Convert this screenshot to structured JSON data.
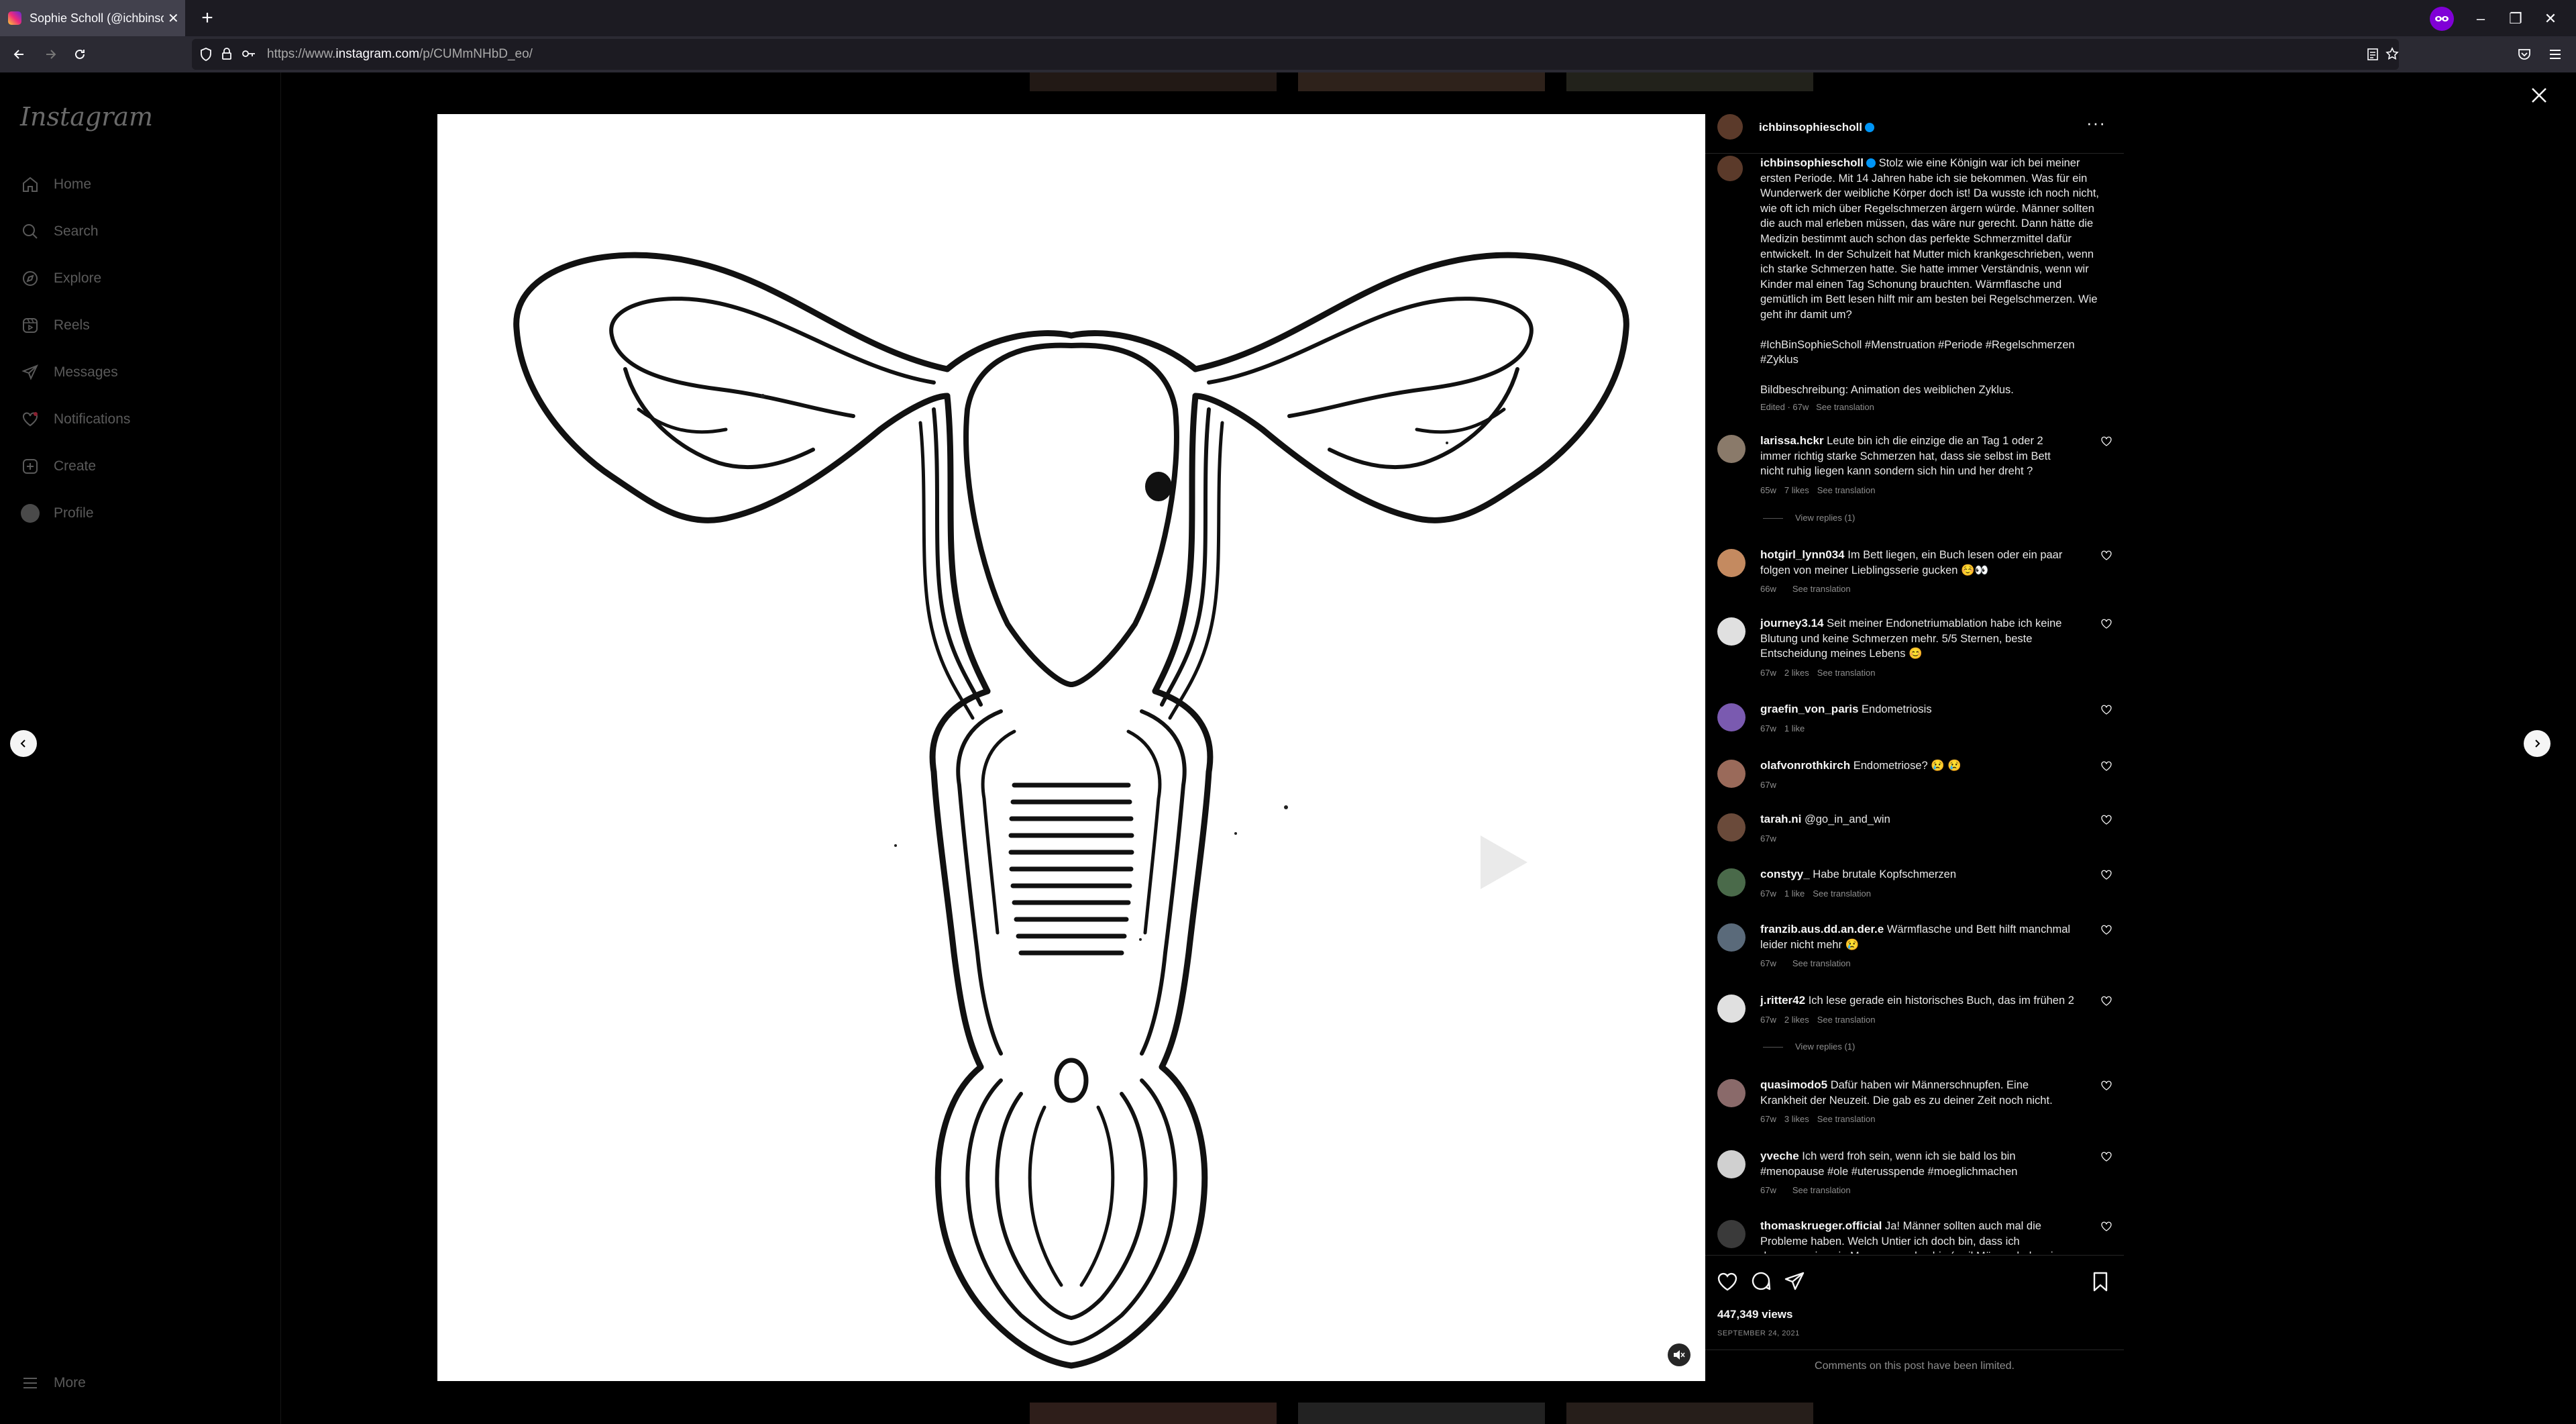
{
  "browser": {
    "tab_title": "Sophie Scholl (@ichbinsophiescholl)",
    "url_prefix": "https://www.",
    "url_domain": "instagram.com",
    "url_path": "/p/CUMmNHbD_eo/"
  },
  "sidenav": {
    "logo": "Instagram",
    "items": [
      {
        "label": "Home"
      },
      {
        "label": "Search"
      },
      {
        "label": "Explore"
      },
      {
        "label": "Reels"
      },
      {
        "label": "Messages"
      },
      {
        "label": "Notifications"
      },
      {
        "label": "Create"
      },
      {
        "label": "Profile"
      }
    ],
    "more": "More"
  },
  "post": {
    "author": "ichbinsophiescholl",
    "caption": "Stolz wie eine Königin war ich bei meiner ersten Periode. Mit 14 Jahren habe ich sie bekommen. Was für ein Wunderwerk der weibliche Körper doch ist! Da wusste ich noch nicht, wie oft ich mich über Regelschmerzen ärgern würde. Männer sollten die auch mal erleben müssen, das wäre nur gerecht. Dann hätte die Medizin bestimmt auch schon das perfekte Schmerzmittel dafür entwickelt. In der Schulzeit hat Mutter mich krankgeschrieben, wenn ich starke Schmerzen hatte. Sie hatte immer Verständnis, wenn wir Kinder mal einen Tag Schonung brauchten. Wärmflasche und gemütlich im Bett lesen hilft mir am besten bei Regelschmerzen. Wie geht ihr damit um?",
    "hashtags": "#IchBinSophieScholl #Menstruation #Periode #Regelschmerzen #Zyklus",
    "image_description": "Bildbeschreibung: Animation des weiblichen Zyklus.",
    "edited_meta": "Edited · 67w",
    "see_translation": "See translation",
    "views": "447,349 views",
    "date": "SEPTEMBER 24, 2021",
    "limited": "Comments on this post have been limited."
  },
  "comments": [
    {
      "user": "larissa.hckr",
      "text": "Leute bin ich die einzige die an Tag 1 oder 2 immer richtig starke Schmerzen hat, dass sie selbst im Bett nicht ruhig liegen kann sondern sich hin und her dreht ?",
      "age": "65w",
      "likes": "7 likes",
      "translation": "See translation",
      "replies": "View replies (1)",
      "avatar": "#8a7a6a"
    },
    {
      "user": "hotgirl_lynn034",
      "text": "Im Bett liegen, ein Buch lesen oder ein paar folgen von meiner Lieblingsserie gucken ☺️👀",
      "age": "66w",
      "likes": "",
      "translation": "See translation",
      "avatar": "#c48a60"
    },
    {
      "user": "journey3.14",
      "text": "Seit meiner Endonetriumablation habe ich keine Blutung und keine Schmerzen mehr. 5/5 Sternen, beste Entscheidung meines Lebens 😊",
      "age": "67w",
      "likes": "2 likes",
      "translation": "See translation",
      "avatar": "#e0e0e0"
    },
    {
      "user": "graefin_von_paris",
      "text": "Endometriosis",
      "age": "67w",
      "likes": "1 like",
      "translation": "",
      "avatar": "#7a5ab0"
    },
    {
      "user": "olafvonrothkirch",
      "text": "Endometriose? 😢 😢",
      "age": "67w",
      "likes": "",
      "translation": "",
      "avatar": "#9a6a5a"
    },
    {
      "user": "tarah.ni",
      "text": "@go_in_and_win",
      "age": "67w",
      "likes": "",
      "translation": "",
      "avatar": "#6a4a3a"
    },
    {
      "user": "constyy_",
      "text": "Habe brutale Kopfschmerzen",
      "age": "67w",
      "likes": "1 like",
      "translation": "See translation",
      "avatar": "#4a6a4a"
    },
    {
      "user": "franzib.aus.dd.an.der.e",
      "text": "Wärmflasche und Bett hilft manchmal leider nicht mehr 😢",
      "age": "67w",
      "likes": "",
      "translation": "See translation",
      "avatar": "#5a6a7a"
    },
    {
      "user": "j.ritter42",
      "text": "Ich lese gerade ein historisches Buch, das im frühen 2",
      "age": "67w",
      "likes": "2 likes",
      "translation": "See translation",
      "replies": "View replies (1)",
      "avatar": "#e0e0e0"
    },
    {
      "user": "quasimodo5",
      "text": "Dafür haben wir Männerschnupfen. Eine Krankheit der Neuzeit. Die gab es zu deiner Zeit noch nicht.",
      "age": "67w",
      "likes": "3 likes",
      "translation": "See translation",
      "avatar": "#8a6a6a"
    },
    {
      "user": "yveche",
      "text": "Ich werd froh sein, wenn ich sie bald los bin #menopause #ole #uterusspende #moeglichmachen",
      "age": "67w",
      "likes": "",
      "translation": "See translation",
      "avatar": "#d0d0d0"
    },
    {
      "user": "thomaskrueger.official",
      "text": "Ja! Männer sollten auch mal die Probleme haben. Welch Untier ich doch bin, dass ich dummerweise ein Mann geworden bin (weil Männer haben ja",
      "age": "",
      "likes": "",
      "translation": "",
      "avatar": "#3a3a3a"
    }
  ],
  "colors": {
    "accent": "#0095f6",
    "background": "#000000",
    "media_bg": "#ffffff"
  }
}
